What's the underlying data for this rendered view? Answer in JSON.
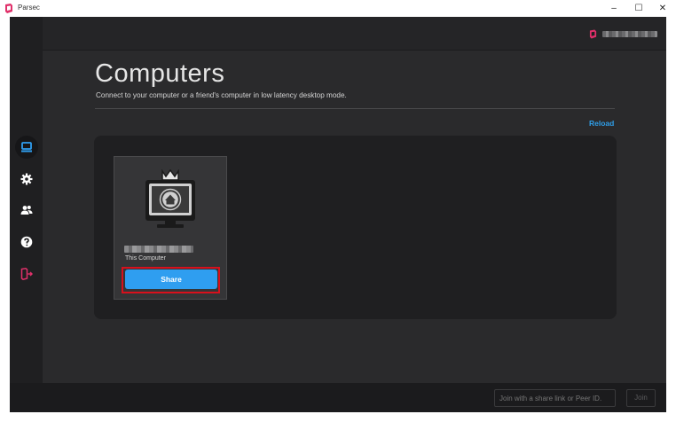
{
  "window": {
    "title": "Parsec",
    "minimize": "–",
    "maximize": "☐",
    "close": "✕"
  },
  "colors": {
    "accent": "#2f9ef0",
    "brand": "#e0306a",
    "highlight": "#d8101c",
    "background": "#2a2a2c"
  },
  "sidebar": {
    "items": [
      {
        "name": "computers",
        "icon": "computer-icon",
        "active": true
      },
      {
        "name": "settings",
        "icon": "gear-icon",
        "active": false
      },
      {
        "name": "friends",
        "icon": "users-icon",
        "active": false
      },
      {
        "name": "help",
        "icon": "help-icon",
        "active": false
      },
      {
        "name": "logout",
        "icon": "logout-icon",
        "active": false
      }
    ]
  },
  "main": {
    "title": "Computers",
    "subtitle": "Connect to your computer or a friend's computer in low latency desktop mode.",
    "reload_label": "Reload",
    "computers": [
      {
        "label": "This Computer",
        "share_label": "Share",
        "icon": "home-monitor-icon"
      }
    ]
  },
  "footer": {
    "join_placeholder": "Join with a share link or Peer ID.",
    "join_label": "Join"
  }
}
